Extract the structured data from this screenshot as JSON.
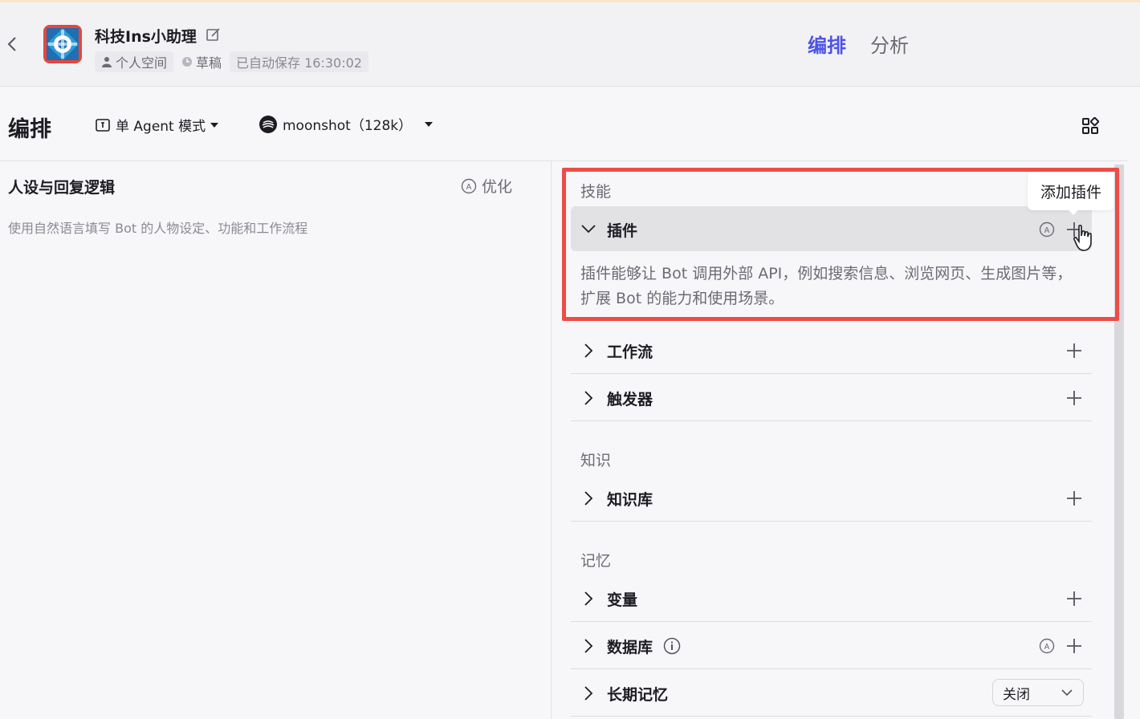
{
  "header": {
    "bot_name": "科技Ins小助理",
    "space": "个人空间",
    "status": "草稿",
    "autosave": "已自动保存 16:30:02",
    "tabs": [
      "编排",
      "分析"
    ]
  },
  "toolbar": {
    "title": "编排",
    "mode": "单 Agent 模式",
    "model": "moonshot（128k）"
  },
  "prompt_panel": {
    "title": "人设与回复逻辑",
    "optimize": "优化",
    "placeholder": "使用自然语言填写 Bot 的人物设定、功能和工作流程"
  },
  "skills": {
    "section": "技能",
    "plugin": {
      "label": "插件",
      "description": "插件能够让 Bot 调用外部 API，例如搜索信息、浏览网页、生成图片等，扩展 Bot 的能力和使用场景。",
      "tooltip": "添加插件"
    },
    "workflow": "工作流",
    "trigger": "触发器"
  },
  "knowledge": {
    "section": "知识",
    "kb": "知识库"
  },
  "memory": {
    "section": "记忆",
    "variable": "变量",
    "database": "数据库",
    "long_term": "长期记忆",
    "long_term_value": "关闭"
  },
  "colors": {
    "accent": "#4d53e8",
    "highlight": "#ef4c46"
  }
}
